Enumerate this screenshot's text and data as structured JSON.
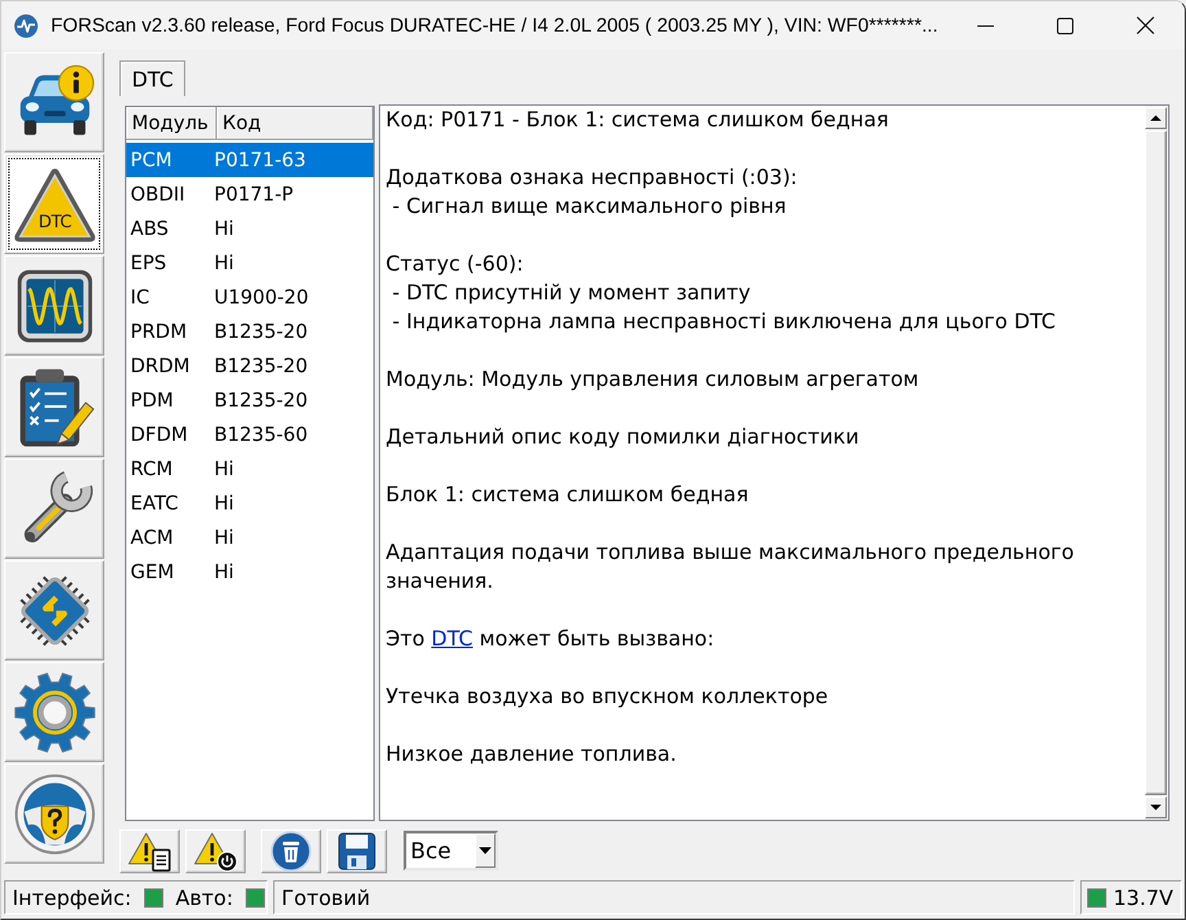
{
  "window": {
    "title": "FORScan v2.3.60 release, Ford Focus DURATEC-HE / I4 2.0L 2005 ( 2003.25 MY ), VIN: WF0*******..."
  },
  "sidebar": {
    "items": [
      {
        "kind": "car",
        "selected": false
      },
      {
        "kind": "triangle",
        "selected": true,
        "icon_text": "DTC"
      },
      {
        "kind": "oscilloscope",
        "selected": false
      },
      {
        "kind": "checklist",
        "selected": false
      },
      {
        "kind": "wrench",
        "selected": false
      },
      {
        "kind": "chip",
        "selected": false
      },
      {
        "kind": "gear",
        "selected": false
      },
      {
        "kind": "wheel",
        "selected": false
      }
    ]
  },
  "tabs": [
    {
      "label": "DTC",
      "selected": true
    }
  ],
  "dtc_table": {
    "columns": [
      "Модуль",
      "Код"
    ],
    "rows": [
      {
        "module": "PCM",
        "code": "P0171-63",
        "selected": true
      },
      {
        "module": "OBDII",
        "code": "P0171-P",
        "selected": false
      },
      {
        "module": "ABS",
        "code": "Hi",
        "selected": false
      },
      {
        "module": "EPS",
        "code": "Hi",
        "selected": false
      },
      {
        "module": "IC",
        "code": "U1900-20",
        "selected": false
      },
      {
        "module": "PRDM",
        "code": "B1235-20",
        "selected": false
      },
      {
        "module": "DRDM",
        "code": "B1235-20",
        "selected": false
      },
      {
        "module": "PDM",
        "code": "B1235-20",
        "selected": false
      },
      {
        "module": "DFDM",
        "code": "B1235-60",
        "selected": false
      },
      {
        "module": "RCM",
        "code": "Hi",
        "selected": false
      },
      {
        "module": "EATC",
        "code": "Hi",
        "selected": false
      },
      {
        "module": "ACM",
        "code": "Hi",
        "selected": false
      },
      {
        "module": "GEM",
        "code": "Hi",
        "selected": false
      }
    ]
  },
  "details": {
    "paragraphs": [
      {
        "kind": "text",
        "lines": [
          "Код: P0171 - Блок 1: система слишком бедная"
        ]
      },
      {
        "kind": "text",
        "lines": [
          "Додаткова ознака несправності (:03):",
          " - Сигнал вище максимального рівня"
        ]
      },
      {
        "kind": "text",
        "lines": [
          "Статус (-60):",
          " - DTC присутній у момент запиту",
          " - Індикаторна лампа несправності виключена для цього DTC"
        ]
      },
      {
        "kind": "text",
        "lines": [
          "Модуль: Модуль управления силовым агрегатом"
        ]
      },
      {
        "kind": "text",
        "lines": [
          "Детальний опис коду помилки діагностики"
        ]
      },
      {
        "kind": "text",
        "lines": [
          "Блок 1: система слишком бедная"
        ]
      },
      {
        "kind": "text",
        "lines": [
          "Адаптация подачи топлива выше максимального предельного значения."
        ]
      },
      {
        "kind": "link",
        "before": "Это ",
        "link": "DTC",
        "after": " может быть вызвано:"
      },
      {
        "kind": "text",
        "lines": [
          "Утечка воздуха во впускном коллекторе"
        ]
      },
      {
        "kind": "text",
        "lines": [
          "Низкое давление топлива."
        ]
      }
    ]
  },
  "toolbar": {
    "button_groups": [
      [
        {
          "kind": "warning-document"
        },
        {
          "kind": "warning-power"
        }
      ],
      [
        {
          "kind": "delete"
        },
        {
          "kind": "save"
        }
      ]
    ],
    "filter": {
      "value": "Все"
    }
  },
  "status_bar": {
    "indicators": [
      {
        "label": "Інтерфейс:",
        "on": true
      },
      {
        "label": "Авто:",
        "on": true
      }
    ],
    "message": "Готовий",
    "voltage": {
      "on": true,
      "reading": "13.7V"
    }
  }
}
